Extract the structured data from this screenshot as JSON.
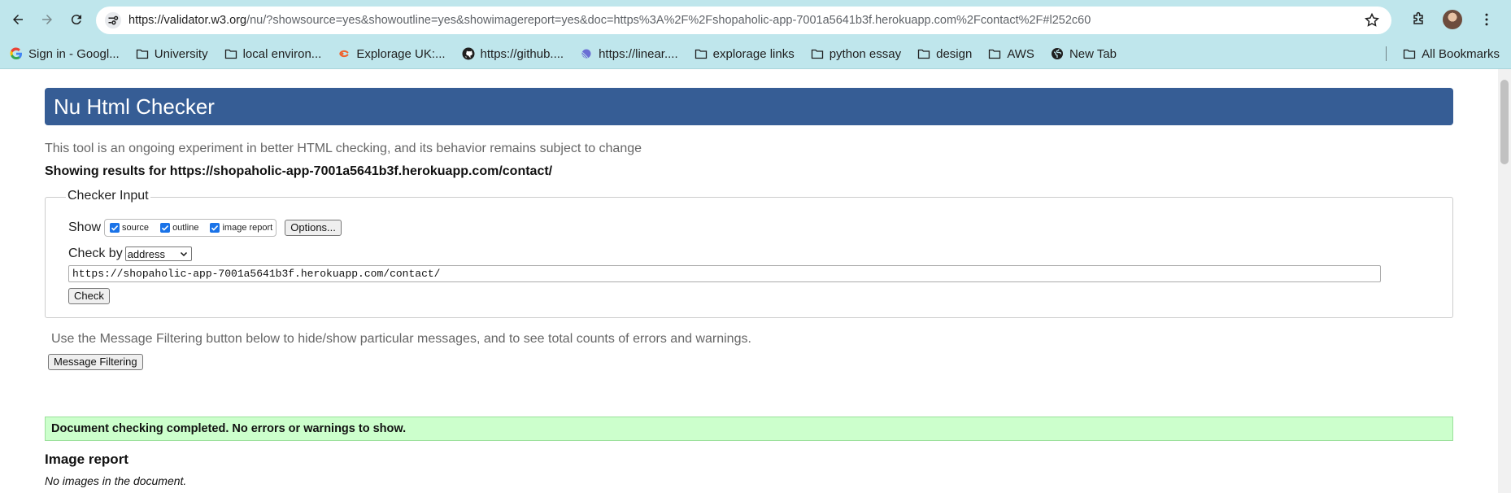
{
  "browser": {
    "url_host": "https://validator.w3.org",
    "url_rest": "/nu/?showsource=yes&showoutline=yes&showimagereport=yes&doc=https%3A%2F%2Fshopaholic-app-7001a5641b3f.herokuapp.com%2Fcontact%2F#l252c60",
    "bookmarks": [
      {
        "label": "Sign in - Googl...",
        "icon": "google-icon"
      },
      {
        "label": "University",
        "icon": "folder-icon"
      },
      {
        "label": "local environ...",
        "icon": "folder-icon"
      },
      {
        "label": "Explorage UK:...",
        "icon": "explorage-icon"
      },
      {
        "label": "https://github....",
        "icon": "github-icon"
      },
      {
        "label": "https://linear....",
        "icon": "linear-icon"
      },
      {
        "label": "explorage links",
        "icon": "folder-icon"
      },
      {
        "label": "python essay",
        "icon": "folder-icon"
      },
      {
        "label": "design",
        "icon": "folder-icon"
      },
      {
        "label": "AWS",
        "icon": "folder-icon"
      },
      {
        "label": "New Tab",
        "icon": "globe-icon"
      }
    ],
    "all_bookmarks": "All Bookmarks"
  },
  "page": {
    "title": "Nu Html Checker",
    "intro": "This tool is an ongoing experiment in better HTML checking, and its behavior remains subject to change",
    "results_heading": "Showing results for https://shopaholic-app-7001a5641b3f.herokuapp.com/contact/",
    "checker_input": {
      "legend": "Checker Input",
      "show_label": "Show",
      "checkboxes": [
        {
          "label": "source",
          "checked": true
        },
        {
          "label": "outline",
          "checked": true
        },
        {
          "label": "image report",
          "checked": true
        }
      ],
      "options_button": "Options...",
      "check_by_label": "Check by",
      "check_by_value": "address",
      "address_value": "https://shopaholic-app-7001a5641b3f.herokuapp.com/contact/",
      "check_button": "Check"
    },
    "filter_note": "Use the Message Filtering button below to hide/show particular messages, and to see total counts of errors and warnings.",
    "filter_button": "Message Filtering",
    "success_message": "Document checking completed. No errors or warnings to show.",
    "image_report_heading": "Image report",
    "no_images": "No images in the document."
  },
  "colors": {
    "chrome_bg": "#bfe6ec",
    "banner_bg": "#365d95",
    "success_bg": "#ccffcc",
    "checkbox_accent": "#1a73e8"
  }
}
